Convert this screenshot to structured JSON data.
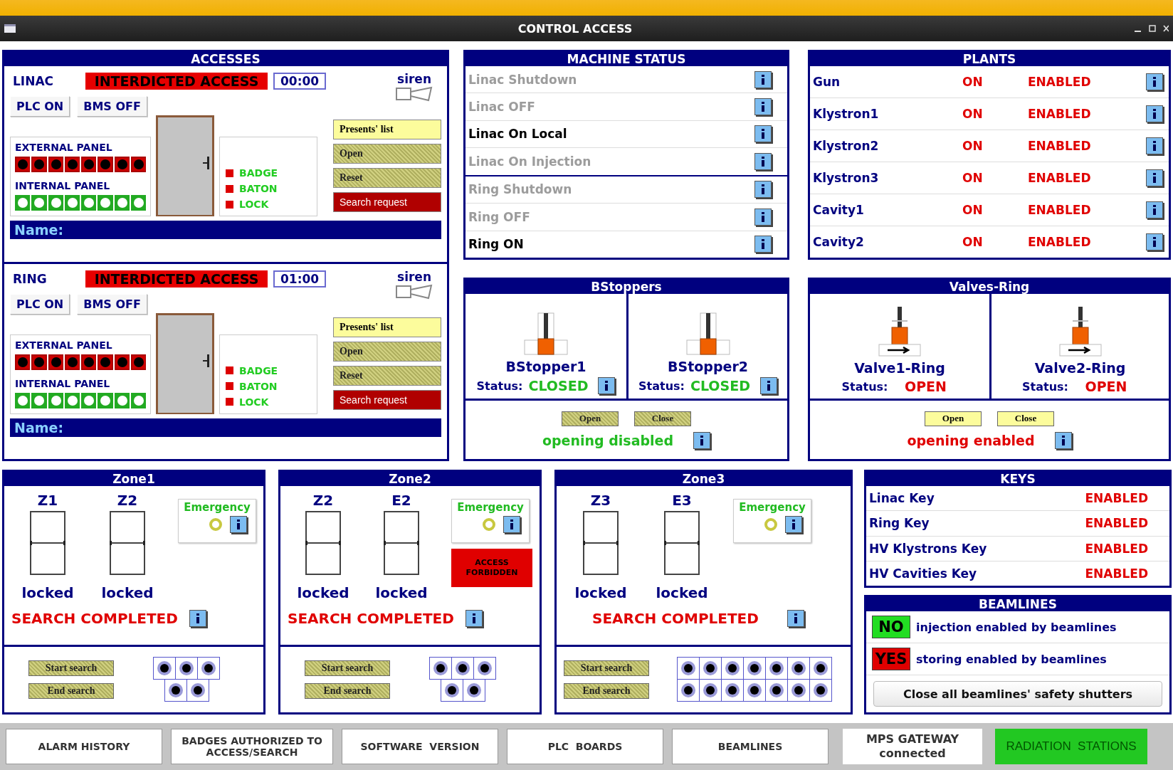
{
  "window": {
    "title": "CONTROL ACCESS"
  },
  "accesses": {
    "title": "ACCESSES",
    "areas": [
      {
        "name": "LINAC",
        "alarm": "INTERDICTED ACCESS",
        "timer": "00:00",
        "siren": "siren",
        "plc": "PLC ON",
        "bms": "BMS OFF",
        "panels": [
          {
            "label": "EXTERNAL PANEL",
            "lights": [
              {
                "kind": "fault"
              },
              {
                "kind": "fault"
              },
              {
                "kind": "fault"
              },
              {
                "kind": "fault"
              },
              {
                "kind": "fault"
              },
              {
                "kind": "fault"
              },
              {
                "kind": "fault"
              },
              {
                "kind": "fault"
              }
            ]
          },
          {
            "label": "INTERNAL PANEL",
            "lights": [
              {
                "kind": "ok"
              },
              {
                "kind": "ok"
              },
              {
                "kind": "ok"
              },
              {
                "kind": "ok"
              },
              {
                "kind": "ok"
              },
              {
                "kind": "ok"
              },
              {
                "kind": "ok"
              },
              {
                "kind": "ok"
              }
            ]
          }
        ],
        "checks": [
          {
            "label": "BADGE",
            "on": true
          },
          {
            "label": "BATON",
            "on": true
          },
          {
            "label": "LOCK",
            "on": true
          }
        ],
        "buttons": [
          {
            "label": "Presents' list",
            "kind": "normal"
          },
          {
            "label": "Open",
            "kind": "disabled"
          },
          {
            "label": "Reset",
            "kind": "disabled"
          },
          {
            "label": "Search request",
            "kind": "danger"
          }
        ],
        "name_label": "Name:"
      },
      {
        "name": "RING",
        "alarm": "INTERDICTED ACCESS",
        "timer": "01:00",
        "siren": "siren",
        "plc": "PLC ON",
        "bms": "BMS OFF",
        "panels": [
          {
            "label": "EXTERNAL PANEL",
            "lights": [
              {
                "kind": "fault"
              },
              {
                "kind": "fault"
              },
              {
                "kind": "fault"
              },
              {
                "kind": "fault"
              },
              {
                "kind": "fault"
              },
              {
                "kind": "fault"
              },
              {
                "kind": "fault"
              },
              {
                "kind": "fault"
              }
            ]
          },
          {
            "label": "INTERNAL PANEL",
            "lights": [
              {
                "kind": "ok"
              },
              {
                "kind": "ok"
              },
              {
                "kind": "ok"
              },
              {
                "kind": "ok"
              },
              {
                "kind": "ok"
              },
              {
                "kind": "ok"
              },
              {
                "kind": "ok"
              },
              {
                "kind": "ok"
              }
            ]
          }
        ],
        "checks": [
          {
            "label": "BADGE",
            "on": true
          },
          {
            "label": "BATON",
            "on": true
          },
          {
            "label": "LOCK",
            "on": true
          }
        ],
        "buttons": [
          {
            "label": "Presents' list",
            "kind": "normal"
          },
          {
            "label": "Open",
            "kind": "disabled"
          },
          {
            "label": "Reset",
            "kind": "disabled"
          },
          {
            "label": "Search request",
            "kind": "danger"
          }
        ],
        "name_label": "Name:"
      }
    ]
  },
  "machine_status": {
    "title": "MACHINE STATUS",
    "groups": [
      {
        "items": [
          {
            "label": "Linac Shutdown",
            "active": false
          },
          {
            "label": "Linac OFF",
            "active": false
          },
          {
            "label": "Linac On Local",
            "active": true
          },
          {
            "label": "Linac On Injection",
            "active": false
          }
        ]
      },
      {
        "items": [
          {
            "label": "Ring Shutdown",
            "active": false
          },
          {
            "label": "Ring OFF",
            "active": false
          },
          {
            "label": "Ring ON",
            "active": true
          }
        ]
      }
    ]
  },
  "plants": {
    "title": "PLANTS",
    "rows": [
      {
        "name": "Gun",
        "state": "ON",
        "enable": "ENABLED"
      },
      {
        "name": "Klystron1",
        "state": "ON",
        "enable": "ENABLED"
      },
      {
        "name": "Klystron2",
        "state": "ON",
        "enable": "ENABLED"
      },
      {
        "name": "Klystron3",
        "state": "ON",
        "enable": "ENABLED"
      },
      {
        "name": "Cavity1",
        "state": "ON",
        "enable": "ENABLED"
      },
      {
        "name": "Cavity2",
        "state": "ON",
        "enable": "ENABLED"
      }
    ]
  },
  "bstoppers": {
    "title": "BStoppers",
    "kind": "stopper",
    "enabled": false,
    "message": "opening disabled",
    "units": [
      {
        "name": "BStopper1",
        "status_label": "Status:",
        "status": "CLOSED",
        "closed": true
      },
      {
        "name": "BStopper2",
        "status_label": "Status:",
        "status": "CLOSED",
        "closed": true
      }
    ],
    "buttons": [
      {
        "label": "Open"
      },
      {
        "label": "Close"
      }
    ]
  },
  "valves": {
    "title": "Valves-Ring",
    "kind": "valve",
    "enabled": true,
    "message": "opening enabled",
    "units": [
      {
        "name": "Valve1-Ring",
        "status_label": "Status:",
        "status": "OPEN",
        "closed": false
      },
      {
        "name": "Valve2-Ring",
        "status_label": "Status:",
        "status": "OPEN",
        "closed": false
      }
    ],
    "buttons": [
      {
        "label": "Open"
      },
      {
        "label": "Close"
      }
    ]
  },
  "zones": [
    {
      "title": "Zone1",
      "doors": [
        {
          "label": "Z1",
          "state": "locked"
        },
        {
          "label": "Z2",
          "state": "locked"
        }
      ],
      "emergency": "Emergency",
      "search": "SEARCH COMPLETED",
      "buttons": [
        "Start search",
        "End search"
      ],
      "pad_rows": [
        {
          "cells": [
            {
              "kind": "dot"
            },
            {
              "kind": "dot"
            },
            {
              "kind": "dot"
            }
          ]
        },
        {
          "cells": [
            {
              "kind": "dot"
            },
            {
              "kind": "dot"
            }
          ]
        }
      ]
    },
    {
      "title": "Zone2",
      "doors": [
        {
          "label": "Z2",
          "state": "locked"
        },
        {
          "label": "E2",
          "state": "locked"
        }
      ],
      "emergency": "Emergency",
      "forbidden": "ACCESS FORBIDDEN",
      "search": "SEARCH COMPLETED",
      "buttons": [
        "Start search",
        "End search"
      ],
      "pad_rows": [
        {
          "cells": [
            {
              "kind": "dot"
            },
            {
              "kind": "dot"
            },
            {
              "kind": "dot"
            }
          ]
        },
        {
          "cells": [
            {
              "kind": "dot"
            },
            {
              "kind": "dot"
            }
          ]
        }
      ]
    },
    {
      "title": "Zone3",
      "doors": [
        {
          "label": "Z3",
          "state": "locked"
        },
        {
          "label": "E3",
          "state": "locked"
        }
      ],
      "emergency": "Emergency",
      "search": "SEARCH COMPLETED",
      "buttons": [
        "Start search",
        "End search"
      ],
      "pad_rows": [
        {
          "cells": [
            {
              "kind": "dot"
            },
            {
              "kind": "dot"
            },
            {
              "kind": "dot"
            },
            {
              "kind": "dot"
            },
            {
              "kind": "dot"
            },
            {
              "kind": "dot"
            },
            {
              "kind": "dot"
            }
          ]
        },
        {
          "cells": [
            {
              "kind": "dot"
            },
            {
              "kind": "dot"
            },
            {
              "kind": "dot"
            },
            {
              "kind": "dot"
            },
            {
              "kind": "dot"
            },
            {
              "kind": "dot"
            },
            {
              "kind": "dot"
            }
          ]
        }
      ]
    }
  ],
  "keys": {
    "title": "KEYS",
    "rows": [
      {
        "name": "Linac Key",
        "status": "ENABLED"
      },
      {
        "name": "Ring Key",
        "status": "ENABLED"
      },
      {
        "name": "HV Klystrons Key",
        "status": "ENABLED"
      },
      {
        "name": "HV Cavities Key",
        "status": "ENABLED"
      }
    ]
  },
  "beamlines": {
    "title": "BEAMLINES",
    "rows": [
      {
        "flag": "NO",
        "color": "#22dd22",
        "text": "injection enabled by beamlines"
      },
      {
        "flag": "YES",
        "color": "#e00000",
        "text": "storing enabled by beamlines"
      }
    ],
    "button": "Close all beamlines' safety shutters"
  },
  "bottom_bar": {
    "buttons": [
      {
        "label": "ALARM HISTORY",
        "kind": "nav"
      },
      {
        "label": "BADGES AUTHORIZED TO ACCESS/SEARCH",
        "kind": "nav"
      },
      {
        "label": "SOFTWARE  VERSION",
        "kind": "nav"
      },
      {
        "label": "PLC  BOARDS",
        "kind": "nav"
      },
      {
        "label": "BEAMLINES",
        "kind": "nav"
      },
      {
        "label": "MPS GATEWAY",
        "status": "connected",
        "kind": "status"
      },
      {
        "label": "RADIATION  STATIONS",
        "kind": "alert"
      }
    ]
  }
}
